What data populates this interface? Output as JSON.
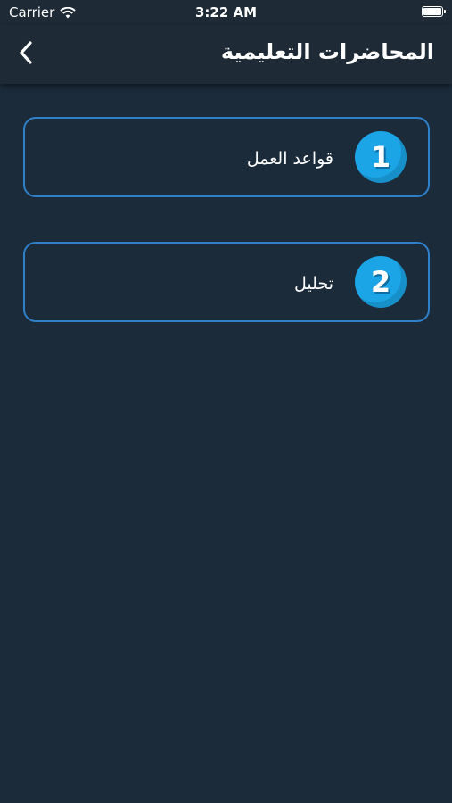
{
  "status_bar": {
    "carrier": "Carrier",
    "time": "3:22 AM"
  },
  "header": {
    "title": "المحاضرات التعليمية"
  },
  "lectures": [
    {
      "number": "1",
      "label": "قواعد العمل"
    },
    {
      "number": "2",
      "label": "تحليل"
    }
  ],
  "colors": {
    "background": "#1b2b3a",
    "bar": "#1e2a35",
    "accent_border": "#2f7fc9",
    "badge": "#1ba4e6"
  }
}
